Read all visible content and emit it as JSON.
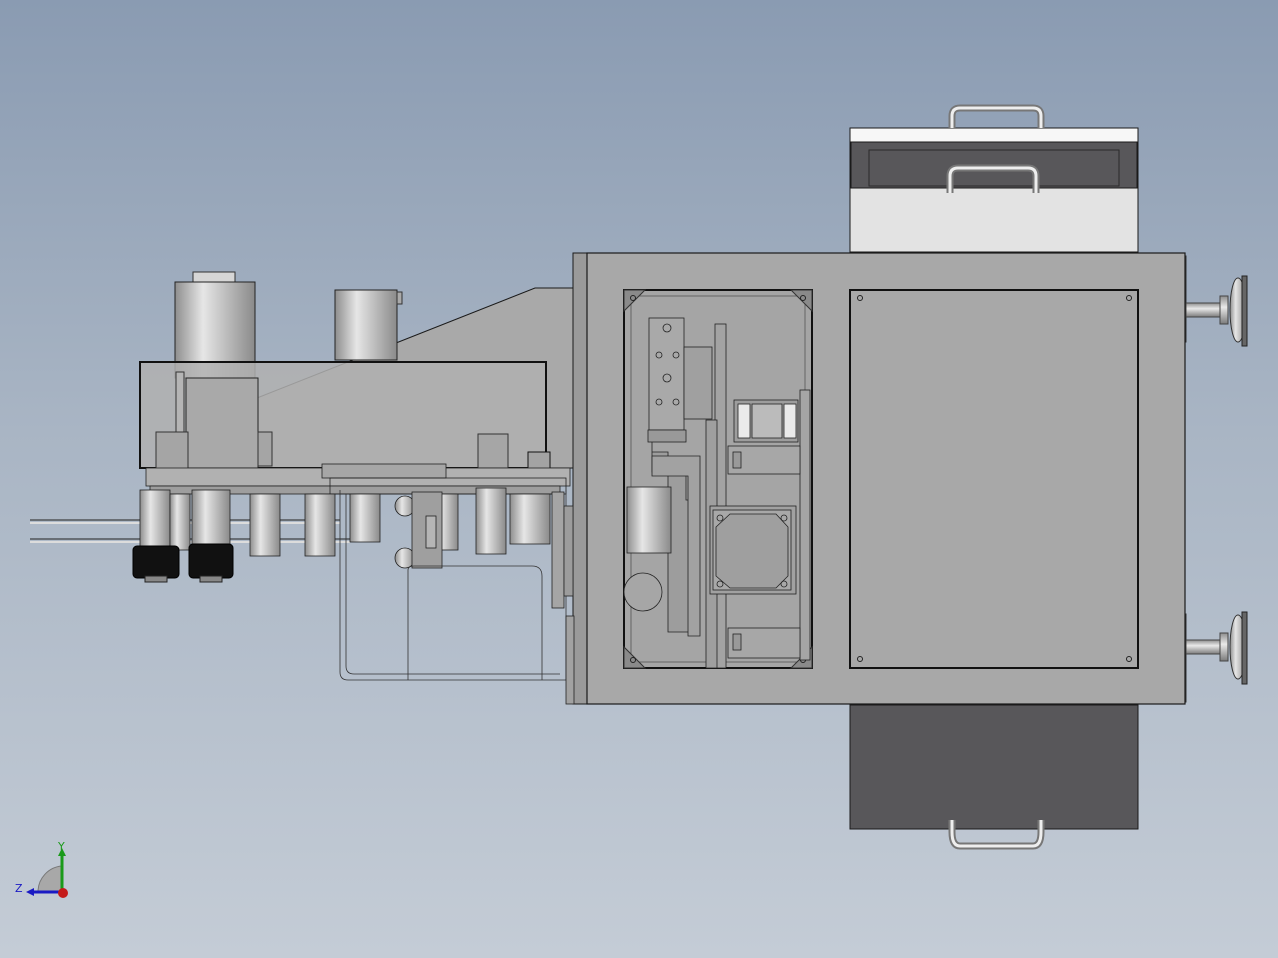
{
  "viewport": {
    "background_top": "#8a9bb2",
    "background_bottom": "#c4ccd6"
  },
  "model": {
    "body_color": "#a8a8a8",
    "dark_panel_color": "#58575a",
    "light_panel_color": "#e3e3e3",
    "edge_color": "#1a1a1a"
  },
  "triad": {
    "x_color": "#c41a1a",
    "y_color": "#1a9a1a",
    "z_color": "#1a1ac4",
    "y_label": "Y",
    "z_label": "Z"
  }
}
